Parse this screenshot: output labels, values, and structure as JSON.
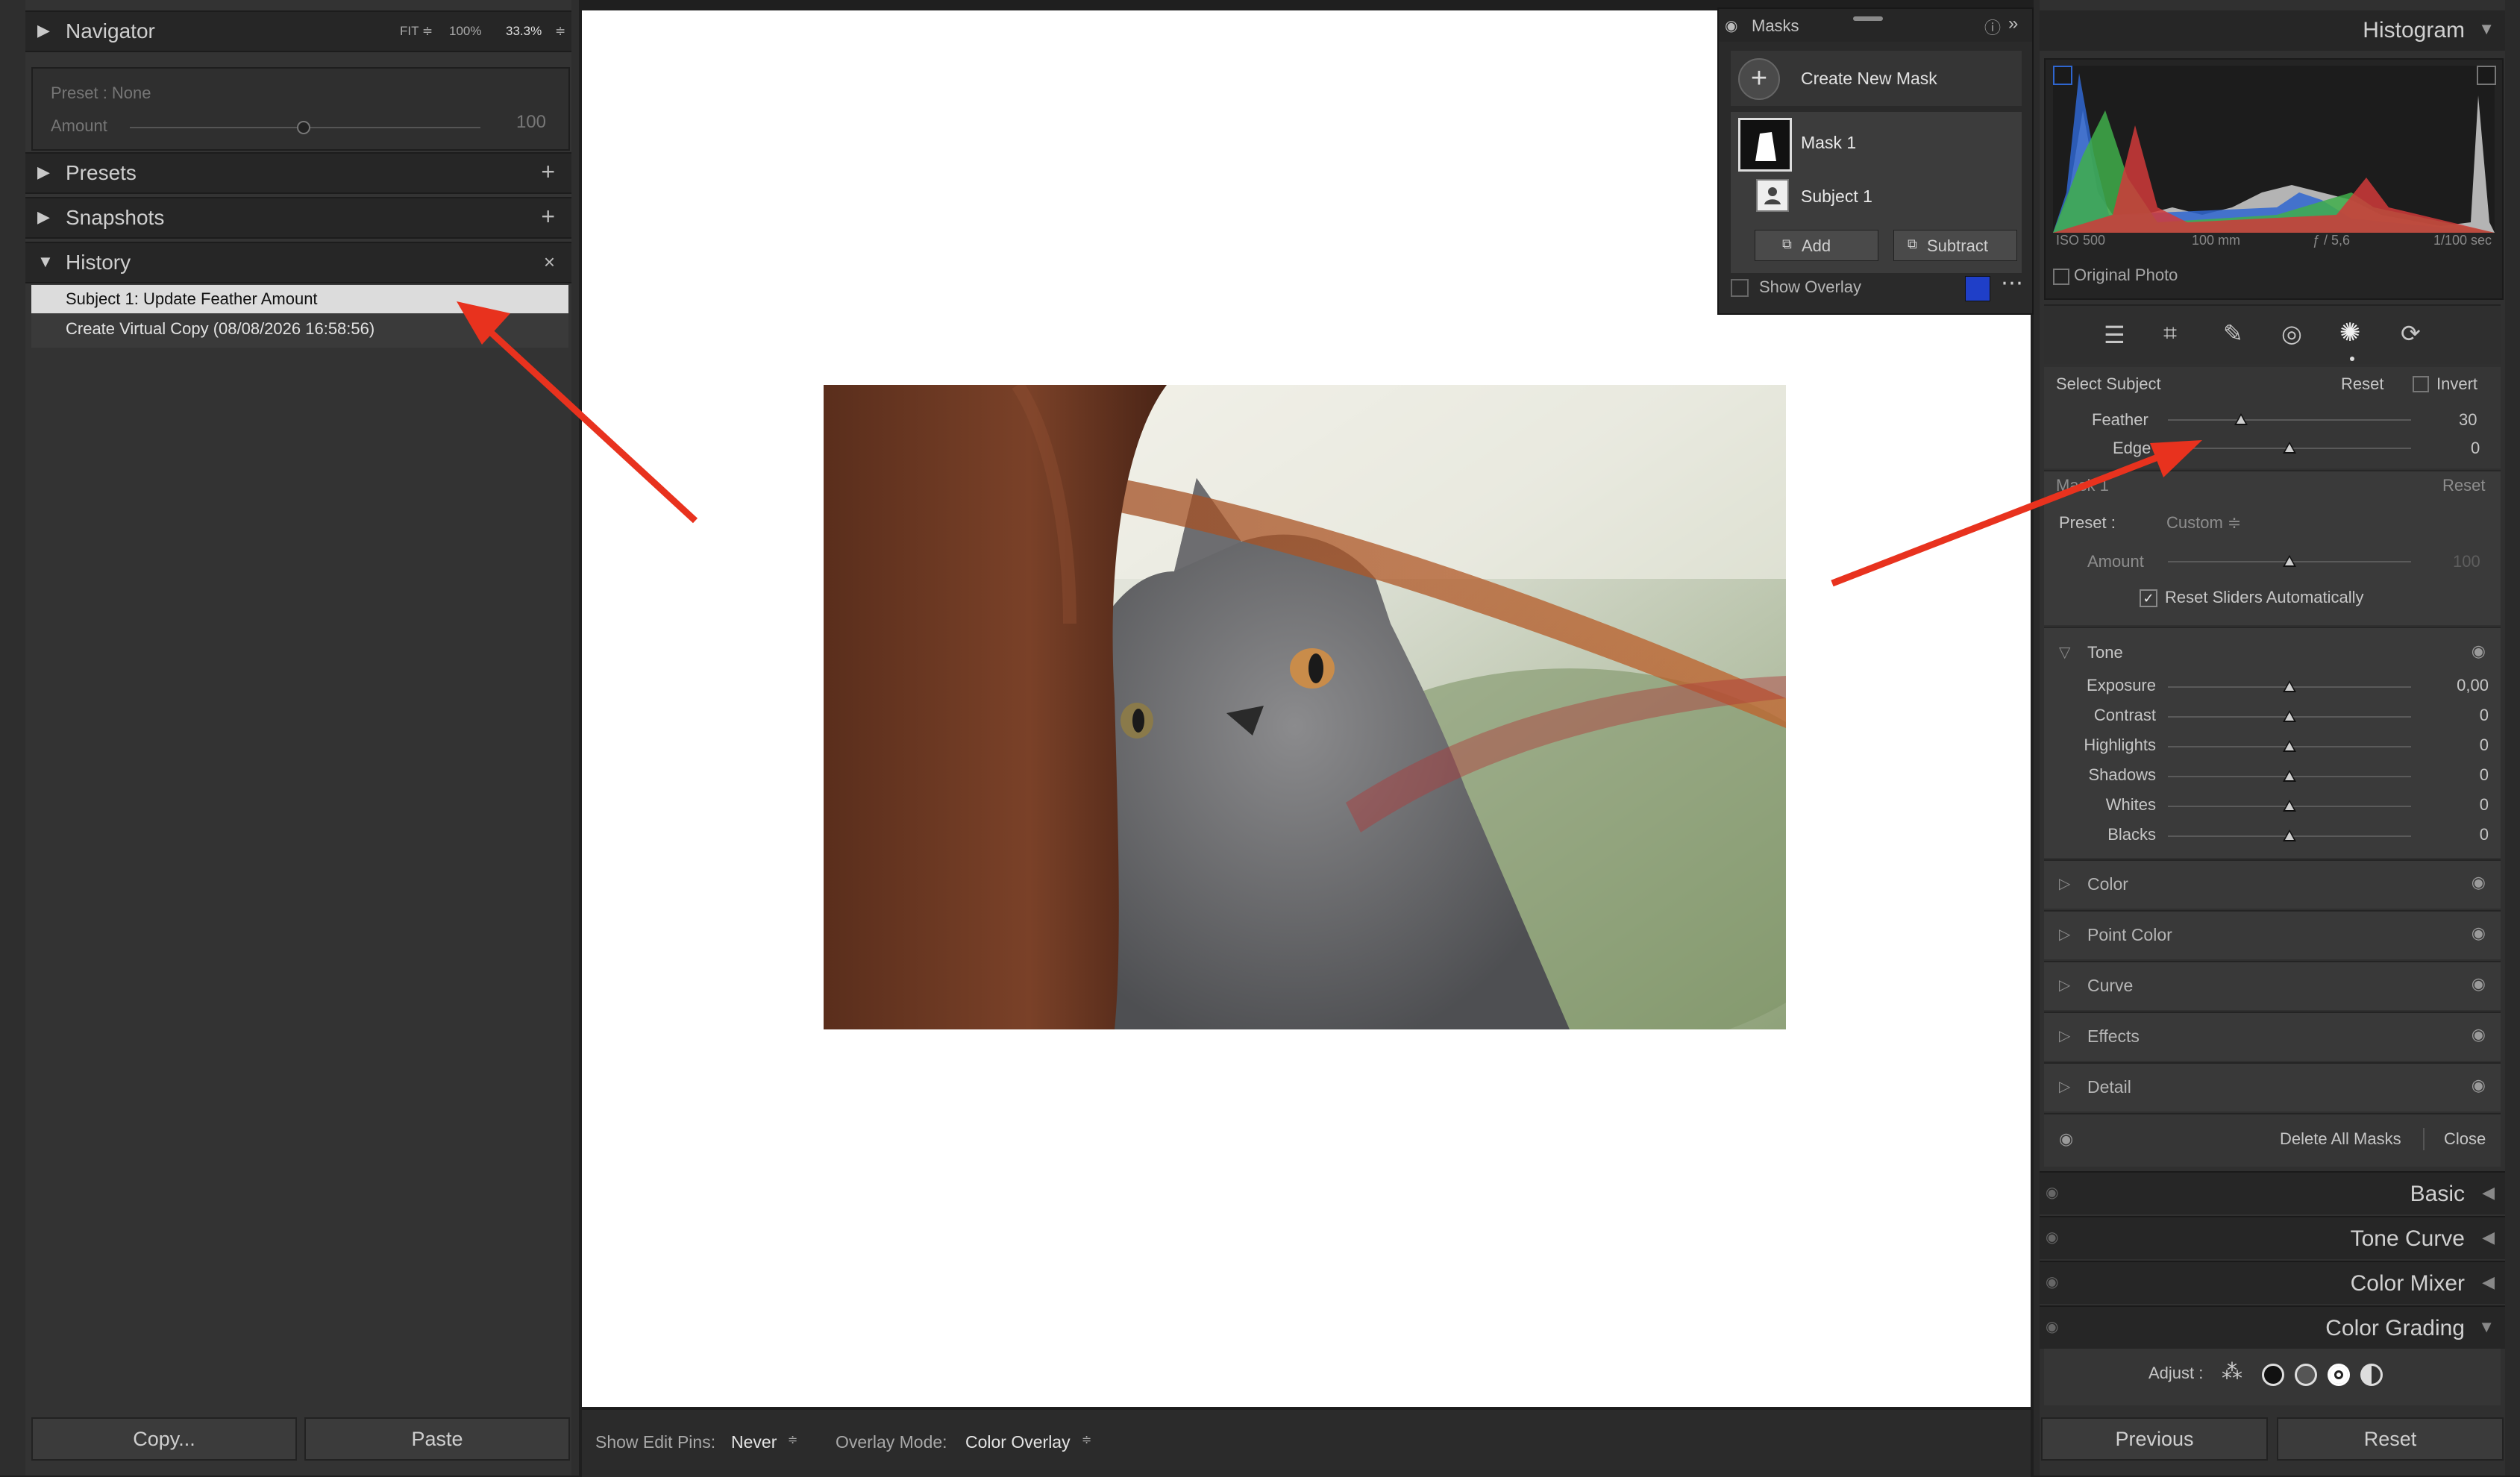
{
  "navigator": {
    "title": "Navigator",
    "fit": "FIT ≑",
    "zoom100": "100%",
    "zoom333": "33.3%",
    "zoom_arrow": "≑"
  },
  "preset_box": {
    "preset_label": "Preset : None",
    "amount_label": "Amount",
    "amount_value": "100"
  },
  "panels": {
    "presets": "Presets",
    "snapshots": "Snapshots",
    "history": "History"
  },
  "history": [
    {
      "label": "Subject 1: Update Feather Amount",
      "selected": true
    },
    {
      "label": "Create Virtual Copy (08/08/2026 16:58:56)",
      "selected": false
    }
  ],
  "left_buttons": {
    "copy": "Copy...",
    "paste": "Paste"
  },
  "bottom_bar": {
    "pins_label": "Show Edit Pins:",
    "pins_value": "Never",
    "overlay_label": "Overlay Mode:",
    "overlay_value": "Color Overlay"
  },
  "masks_popup": {
    "title": "Masks",
    "create": "Create New Mask",
    "mask1": "Mask 1",
    "subject1": "Subject 1",
    "add": "Add",
    "subtract": "Subtract",
    "show_overlay": "Show Overlay",
    "overlay_color": "#1f3fc8"
  },
  "histogram": {
    "title": "Histogram",
    "iso": "ISO 500",
    "focal": "100 mm",
    "aperture": "ƒ / 5,6",
    "shutter": "1/100 sec",
    "original_photo": "Original Photo"
  },
  "select_subject": {
    "title": "Select Subject",
    "reset": "Reset",
    "invert": "Invert",
    "feather_label": "Feather",
    "feather_value": "30",
    "feather_fraction": 0.3,
    "edge_label": "Edge",
    "edge_value": "0"
  },
  "mask_section": {
    "title": "Mask 1",
    "reset": "Reset",
    "preset_label": "Preset :",
    "preset_value": "Custom ≑",
    "amount_label": "Amount",
    "amount_value": "100",
    "reset_sliders": "Reset Sliders Automatically"
  },
  "tone": {
    "title": "Tone",
    "sliders": [
      {
        "label": "Exposure",
        "value": "0,00"
      },
      {
        "label": "Contrast",
        "value": "0"
      },
      {
        "label": "Highlights",
        "value": "0"
      },
      {
        "label": "Shadows",
        "value": "0"
      },
      {
        "label": "Whites",
        "value": "0"
      },
      {
        "label": "Blacks",
        "value": "0"
      }
    ]
  },
  "collapsed_sections": [
    "Color",
    "Point Color",
    "Curve",
    "Effects",
    "Detail"
  ],
  "mask_footer": {
    "delete_all": "Delete All Masks",
    "close": "Close"
  },
  "right_panels": [
    "Basic",
    "Tone Curve",
    "Color Mixer",
    "Color Grading"
  ],
  "color_grading": {
    "adjust_label": "Adjust :"
  },
  "right_buttons": {
    "previous": "Previous",
    "reset": "Reset"
  },
  "annotation_color": "#e8321e"
}
